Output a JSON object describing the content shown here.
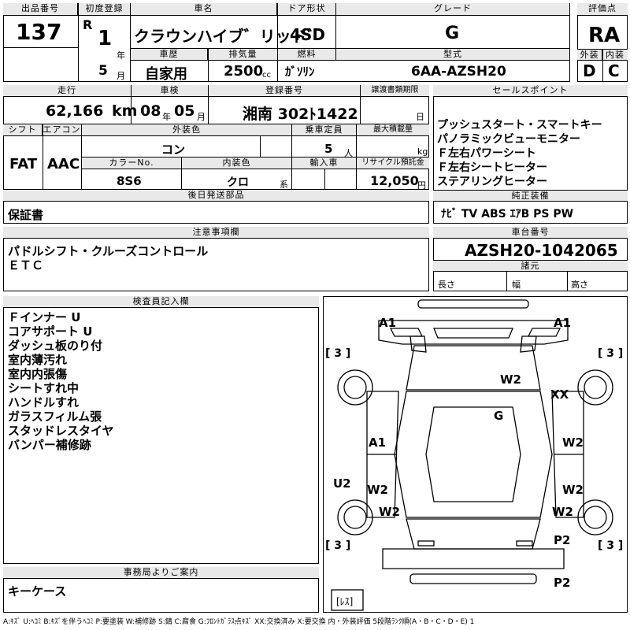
{
  "header": {
    "labels": {
      "lot_no": "出品番号",
      "first_reg": "初度登録",
      "car_name": "車名",
      "door_type": "ドア形状",
      "grade": "グレード",
      "rating": "評価点",
      "history": "車歴",
      "displacement": "排気量",
      "fuel": "燃料",
      "model": "型式",
      "exterior": "外装",
      "interior": "内装"
    },
    "lot_no": "137",
    "era": "R",
    "reg_year": "1",
    "year_unit": "年",
    "reg_month": "5",
    "month_unit": "月",
    "car_name": "クラウンハイブ゛リッド゛",
    "door_type": "4SD",
    "grade": "G",
    "rating": "RA",
    "history": "自家用",
    "displacement": "2500",
    "cc": "cc",
    "fuel": "ｶﾞｿﾘﾝ",
    "model": "6AA-AZSH20",
    "exterior": "D",
    "interior": "C"
  },
  "info": {
    "labels": {
      "mileage": "走行",
      "inspection": "車検",
      "plate": "登録番号",
      "transfer": "譲渡書類期限",
      "shift": "シフト",
      "aircon": "エアコン",
      "ext_color": "外装色",
      "capacity": "乗車定員",
      "max_load": "最大積載量",
      "color_no": "カラーNo.",
      "int_color": "内装色",
      "import": "輸入車",
      "recycle": "リサイクル預託金"
    },
    "mileage": "62,166",
    "km": "km",
    "insp_year": "08",
    "insp_month": "05",
    "year_unit": "年",
    "month_unit": "月",
    "plate": "湘南 302ﾄ1422",
    "transfer_day": "日",
    "shift": "FAT",
    "aircon": "AAC",
    "ext_color": "コン",
    "capacity": "5",
    "capacity_unit": "人",
    "max_load_unit": "kg",
    "color_no": "8S6",
    "int_color": "クロ",
    "int_color_unit": "系",
    "recycle": "12,050",
    "recycle_unit": "円"
  },
  "sales_points": {
    "title": "セールスポイント",
    "items": [
      "プッシュスタート・スマートキー",
      "パノラミックビューモニター",
      "Ｆ左右パワーシート",
      "Ｆ左右シートヒーター",
      "ステアリングヒーター"
    ]
  },
  "later_parts": {
    "title": "後日発送部品",
    "value": "保証書"
  },
  "equipment": {
    "title": "純正装備",
    "value": "ﾅﾋﾞ  TV  ABS  ｴｱB  PS  PW"
  },
  "notes": {
    "title": "注意事項欄",
    "lines": [
      "パドルシフト・クルーズコントロール",
      "ＥＴＣ"
    ]
  },
  "chassis": {
    "title": "車台番号",
    "value": "AZSH20-1042065",
    "specs_title": "諸元",
    "length": "長さ",
    "width": "幅",
    "height": "高さ"
  },
  "inspector": {
    "title": "検査員記入欄",
    "items": [
      "Ｆインナー U",
      "コアサポート U",
      "ダッシュ板のり付",
      "室内薄汚れ",
      "室内内張傷",
      "シートすれ中",
      "ハンドルすれ",
      "ガラスフィルム張",
      "スタッドレスタイヤ",
      "バンパー補修跡"
    ]
  },
  "office": {
    "title": "事務局よりご案内",
    "value": "キーケース"
  },
  "diagram": {
    "marks": {
      "front_left": "A1",
      "front_right": "A1",
      "hood": "W2",
      "right_fender": "XX",
      "roof": "G",
      "left_front_door": "A1",
      "right_front_door": "W2",
      "left_rear_door": "W2",
      "right_rear_door": "W2",
      "left_rear_quarter": "W2",
      "right_rear_quarter": "W2",
      "left_sill": "U2",
      "right_rear_corner": "P2",
      "rear_bumper": "P2"
    },
    "tire_labels": [
      "[ 3 ]",
      "[ 3 ]",
      "[ 3 ]",
      "[ 3 ]"
    ],
    "spare": "[ﾚｽ]"
  },
  "legend": "A:ｷｽﾞ U:ﾍｺﾐ B:ｷｽﾞを伴うﾍｺﾐ P:要塗装 W:補修跡 S:錆 C:腐食 G:ﾌﾛﾝﾄｶﾞﾗｽ点ｷｽﾞ XX:交換済み X:要交換  内・外装評価 5段階ﾗﾝｸ順(A・B・C・D・E) 1"
}
